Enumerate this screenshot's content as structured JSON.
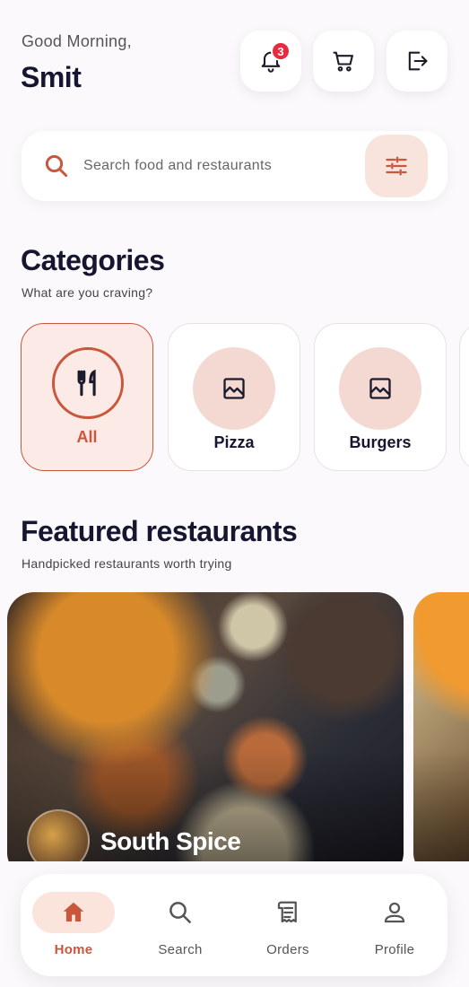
{
  "header": {
    "greeting": "Good Morning,",
    "username": "Smit",
    "notification_count": "3"
  },
  "header_icons": [
    "bell-icon",
    "cart-icon",
    "logout-icon"
  ],
  "search": {
    "placeholder": "Search food and restaurants",
    "filter_icon": "sliders-icon"
  },
  "categories": {
    "title": "Categories",
    "subtitle": "What are you craving?",
    "items": [
      {
        "label": "All",
        "icon": "fork-knife-icon",
        "active": true
      },
      {
        "label": "Pizza",
        "icon": "image-placeholder-icon",
        "active": false
      },
      {
        "label": "Burgers",
        "icon": "image-placeholder-icon",
        "active": false
      }
    ]
  },
  "featured": {
    "title": "Featured restaurants",
    "subtitle": "Handpicked restaurants worth trying",
    "restaurants": [
      {
        "name": "South Spice"
      }
    ]
  },
  "nav": {
    "items": [
      {
        "label": "Home",
        "icon": "home-icon",
        "active": true
      },
      {
        "label": "Search",
        "icon": "search-icon",
        "active": false
      },
      {
        "label": "Orders",
        "icon": "receipt-icon",
        "active": false
      },
      {
        "label": "Profile",
        "icon": "person-icon",
        "active": false
      }
    ]
  },
  "colors": {
    "accent": "#c9573d",
    "accent_light": "#fbe4dc",
    "badge": "#e8293e",
    "text_dark": "#161630"
  }
}
